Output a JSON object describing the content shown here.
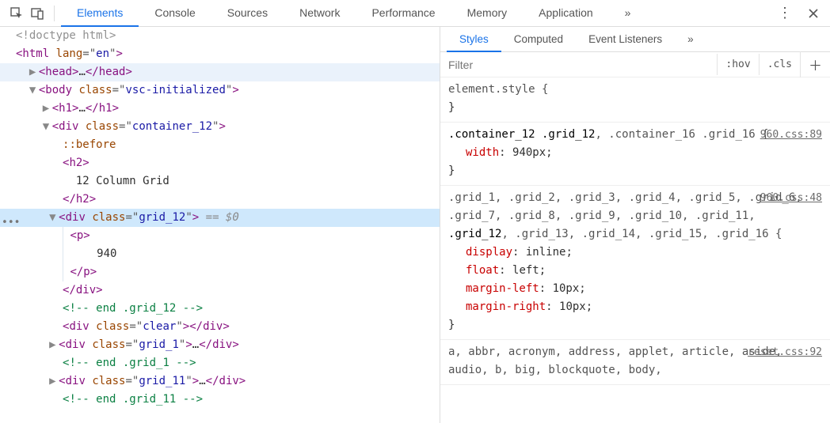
{
  "tabs": [
    "Elements",
    "Console",
    "Sources",
    "Network",
    "Performance",
    "Memory",
    "Application"
  ],
  "activeTab": 0,
  "subtabs": [
    "Styles",
    "Computed",
    "Event Listeners"
  ],
  "activeSubtab": 0,
  "filterPlaceholder": "Filter",
  "hov": ":hov",
  "cls": ".cls",
  "dom": {
    "doctype": "<!doctype html>",
    "htmlOpen": {
      "tag": "html",
      "attr": "lang",
      "val": "en"
    },
    "headOpen": {
      "tag": "head"
    },
    "headEllipsis": "…",
    "headClose": "head",
    "bodyOpen": {
      "tag": "body",
      "attr": "class",
      "val": "vsc-initialized"
    },
    "h1Open": {
      "tag": "h1"
    },
    "h1Ellipsis": "…",
    "h1Close": "h1",
    "divContainer": {
      "tag": "div",
      "attr": "class",
      "val": "container_12"
    },
    "before": "::before",
    "h2Open": {
      "tag": "h2"
    },
    "h2Text": "12 Column Grid",
    "h2Close": "h2",
    "divGrid12": {
      "tag": "div",
      "attr": "class",
      "val": "grid_12"
    },
    "eq": " == $0",
    "pOpen": {
      "tag": "p"
    },
    "pText": "940",
    "pClose": "p",
    "divCloseGrid": "div",
    "commentGrid12": "<!-- end .grid_12 -->",
    "divClear": {
      "tag": "div",
      "attr": "class",
      "val": "clear"
    },
    "divGrid1": {
      "tag": "div",
      "attr": "class",
      "val": "grid_1"
    },
    "grid1Ell": "…",
    "commentGrid1": "<!-- end .grid_1 -->",
    "divGrid11": {
      "tag": "div",
      "attr": "class",
      "val": "grid_11"
    },
    "grid11Ell": "…",
    "commentGrid11": "<!-- end .grid_11 -->"
  },
  "styles": {
    "elementStyle": "element.style {",
    "rule1": {
      "src": "960.css:89",
      "sel": ".container_12 .grid_12, .container_16 .grid_16",
      "match": [
        ".container_12 .grid_12"
      ],
      "props": [
        {
          "name": "width",
          "val": "940px"
        }
      ]
    },
    "rule2": {
      "src": "960.css:48",
      "sel": ".grid_1, .grid_2, .grid_3, .grid_4, .grid_5, .grid_6, .grid_7, .grid_8, .grid_9, .grid_10, .grid_11, .grid_12, .grid_13, .grid_14, .grid_15, .grid_16",
      "match": [
        ".grid_12"
      ],
      "props": [
        {
          "name": "display",
          "val": "inline"
        },
        {
          "name": "float",
          "val": "left"
        },
        {
          "name": "margin-left",
          "val": "10px"
        },
        {
          "name": "margin-right",
          "val": "10px"
        }
      ]
    },
    "rule3": {
      "src": "reset.css:92",
      "sel": "a, abbr, acronym, address, applet, article, aside, audio, b, big, blockquote, body,"
    }
  }
}
